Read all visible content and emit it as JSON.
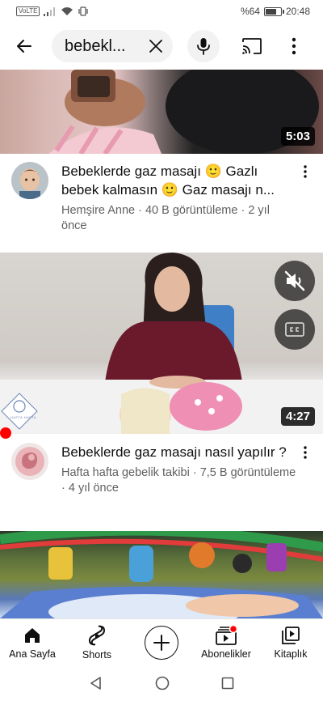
{
  "status_bar": {
    "network_badge": "VoLTE",
    "battery_percent": "%64",
    "battery_level": 0.64,
    "time": "20:48"
  },
  "search": {
    "query": "bebekl..."
  },
  "videos": [
    {
      "duration": "5:03",
      "title": "Bebeklerde gaz masajı 🙂 Gazlı bebek kalmasın 🙂 Gaz masajı n...",
      "channel": "Hemşire Anne",
      "views": "40 B görüntüleme",
      "age": "2 yıl önce"
    },
    {
      "duration": "4:27",
      "title": "Bebeklerde gaz masajı nasıl yapılır ?",
      "channel": "Hafta hafta gebelik takibi",
      "views": "7,5 B görüntüleme",
      "age": "4 yıl önce",
      "watermark": "HAFTA HAFTA"
    }
  ],
  "nav": {
    "home": "Ana Sayfa",
    "shorts": "Shorts",
    "subscriptions": "Abonelikler",
    "library": "Kitaplık"
  },
  "colors": {
    "accent": "#ff0000",
    "text_primary": "#0f0f0f",
    "text_secondary": "#606060"
  }
}
